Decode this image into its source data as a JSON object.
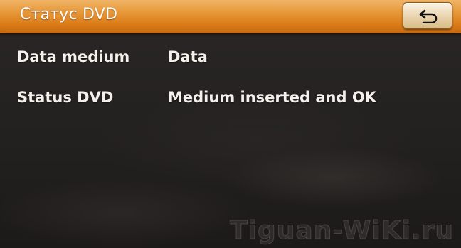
{
  "header": {
    "title": "Статус DVD",
    "back_button_icon": "return-arrow-icon"
  },
  "info_rows": [
    {
      "label": "Data medium",
      "value": "Data"
    },
    {
      "label": "Status DVD",
      "value": "Medium inserted and OK"
    }
  ],
  "watermark": "Tiguan-WiKi.ru",
  "colors": {
    "header_orange": "#dd7f1c",
    "background": "#232120",
    "text": "#f4f1ec"
  }
}
